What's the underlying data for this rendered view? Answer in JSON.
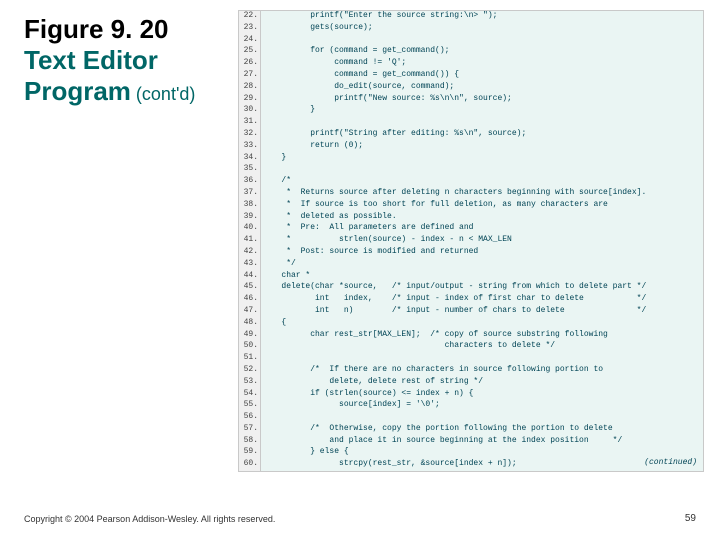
{
  "title": {
    "line1": "Figure 9. 20",
    "line2": "Text Editor",
    "line3_main": "Program",
    "line3_sub": " (cont'd)"
  },
  "footer": "Copyright © 2004 Pearson Addison-Wesley. All rights reserved.",
  "page_number": "59",
  "continued_label": "(continued)",
  "code_lines": [
    {
      "n": "22.",
      "t": "         printf(\"Enter the source string:\\n> \");"
    },
    {
      "n": "23.",
      "t": "         gets(source);"
    },
    {
      "n": "24.",
      "t": ""
    },
    {
      "n": "25.",
      "t": "         for (command = get_command();"
    },
    {
      "n": "26.",
      "t": "              command != 'Q';"
    },
    {
      "n": "27.",
      "t": "              command = get_command()) {"
    },
    {
      "n": "28.",
      "t": "              do_edit(source, command);"
    },
    {
      "n": "29.",
      "t": "              printf(\"New source: %s\\n\\n\", source);"
    },
    {
      "n": "30.",
      "t": "         }"
    },
    {
      "n": "31.",
      "t": ""
    },
    {
      "n": "32.",
      "t": "         printf(\"String after editing: %s\\n\", source);"
    },
    {
      "n": "33.",
      "t": "         return (0);"
    },
    {
      "n": "34.",
      "t": "   }"
    },
    {
      "n": "35.",
      "t": ""
    },
    {
      "n": "36.",
      "t": "   /*"
    },
    {
      "n": "37.",
      "t": "    *  Returns source after deleting n characters beginning with source[index]."
    },
    {
      "n": "38.",
      "t": "    *  If source is too short for full deletion, as many characters are"
    },
    {
      "n": "39.",
      "t": "    *  deleted as possible."
    },
    {
      "n": "40.",
      "t": "    *  Pre:  All parameters are defined and"
    },
    {
      "n": "41.",
      "t": "    *          strlen(source) - index - n < MAX_LEN"
    },
    {
      "n": "42.",
      "t": "    *  Post: source is modified and returned"
    },
    {
      "n": "43.",
      "t": "    */"
    },
    {
      "n": "44.",
      "t": "   char *"
    },
    {
      "n": "45.",
      "t": "   delete(char *source,   /* input/output - string from which to delete part */"
    },
    {
      "n": "46.",
      "t": "          int   index,    /* input - index of first char to delete           */"
    },
    {
      "n": "47.",
      "t": "          int   n)        /* input - number of chars to delete               */"
    },
    {
      "n": "48.",
      "t": "   {"
    },
    {
      "n": "49.",
      "t": "         char rest_str[MAX_LEN];  /* copy of source substring following"
    },
    {
      "n": "50.",
      "t": "                                     characters to delete */"
    },
    {
      "n": "51.",
      "t": ""
    },
    {
      "n": "52.",
      "t": "         /*  If there are no characters in source following portion to"
    },
    {
      "n": "53.",
      "t": "             delete, delete rest of string */"
    },
    {
      "n": "54.",
      "t": "         if (strlen(source) <= index + n) {"
    },
    {
      "n": "55.",
      "t": "               source[index] = '\\0';"
    },
    {
      "n": "56.",
      "t": ""
    },
    {
      "n": "57.",
      "t": "         /*  Otherwise, copy the portion following the portion to delete"
    },
    {
      "n": "58.",
      "t": "             and place it in source beginning at the index position     */"
    },
    {
      "n": "59.",
      "t": "         } else {"
    },
    {
      "n": "60.",
      "t": "               strcpy(rest_str, &source[index + n]);"
    }
  ]
}
